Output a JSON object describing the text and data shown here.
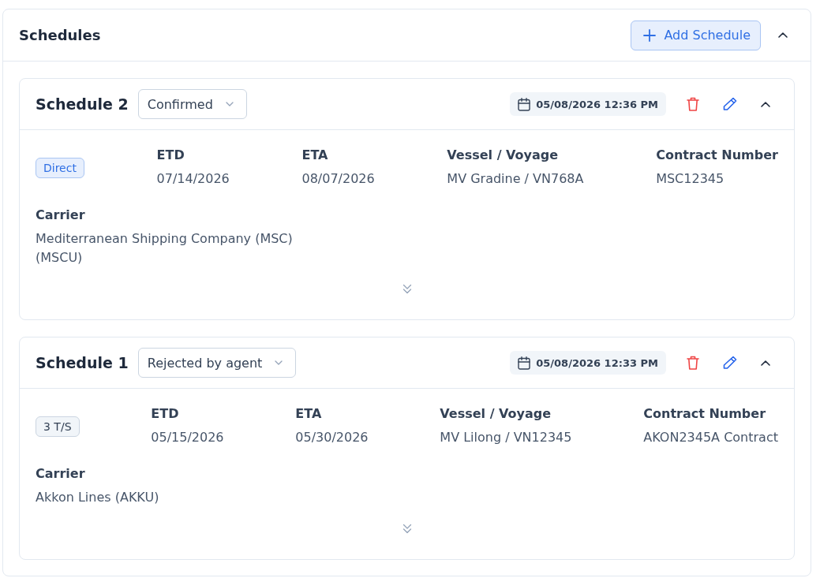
{
  "panel": {
    "title": "Schedules",
    "add_button": "Add Schedule",
    "expanded": true
  },
  "schedules": [
    {
      "title": "Schedule 2",
      "status": "Confirmed",
      "timestamp": "05/08/2026 12:36 PM",
      "expanded": true,
      "routing": {
        "label": "Direct",
        "kind": "direct"
      },
      "fields": [
        {
          "label": "ETD",
          "value": "07/14/2026"
        },
        {
          "label": "ETA",
          "value": "08/07/2026"
        },
        {
          "label": "Vessel / Voyage",
          "value": "MV Gradine / VN768A"
        },
        {
          "label": "Contract Number",
          "value": "MSC12345"
        }
      ],
      "carrier": {
        "label": "Carrier",
        "value": "Mediterranean Shipping Company (MSC) (MSCU)"
      }
    },
    {
      "title": "Schedule 1",
      "status": "Rejected by agent",
      "timestamp": "05/08/2026 12:33 PM",
      "expanded": true,
      "routing": {
        "label": "3 T/S",
        "kind": "transshipment"
      },
      "fields": [
        {
          "label": "ETD",
          "value": "05/15/2026"
        },
        {
          "label": "ETA",
          "value": "05/30/2026"
        },
        {
          "label": "Vessel / Voyage",
          "value": "MV Lilong / VN12345"
        },
        {
          "label": "Contract Number",
          "value": "AKON2345A Contract"
        }
      ],
      "carrier": {
        "label": "Carrier",
        "value": "Akkon Lines (AKKU)"
      }
    }
  ]
}
